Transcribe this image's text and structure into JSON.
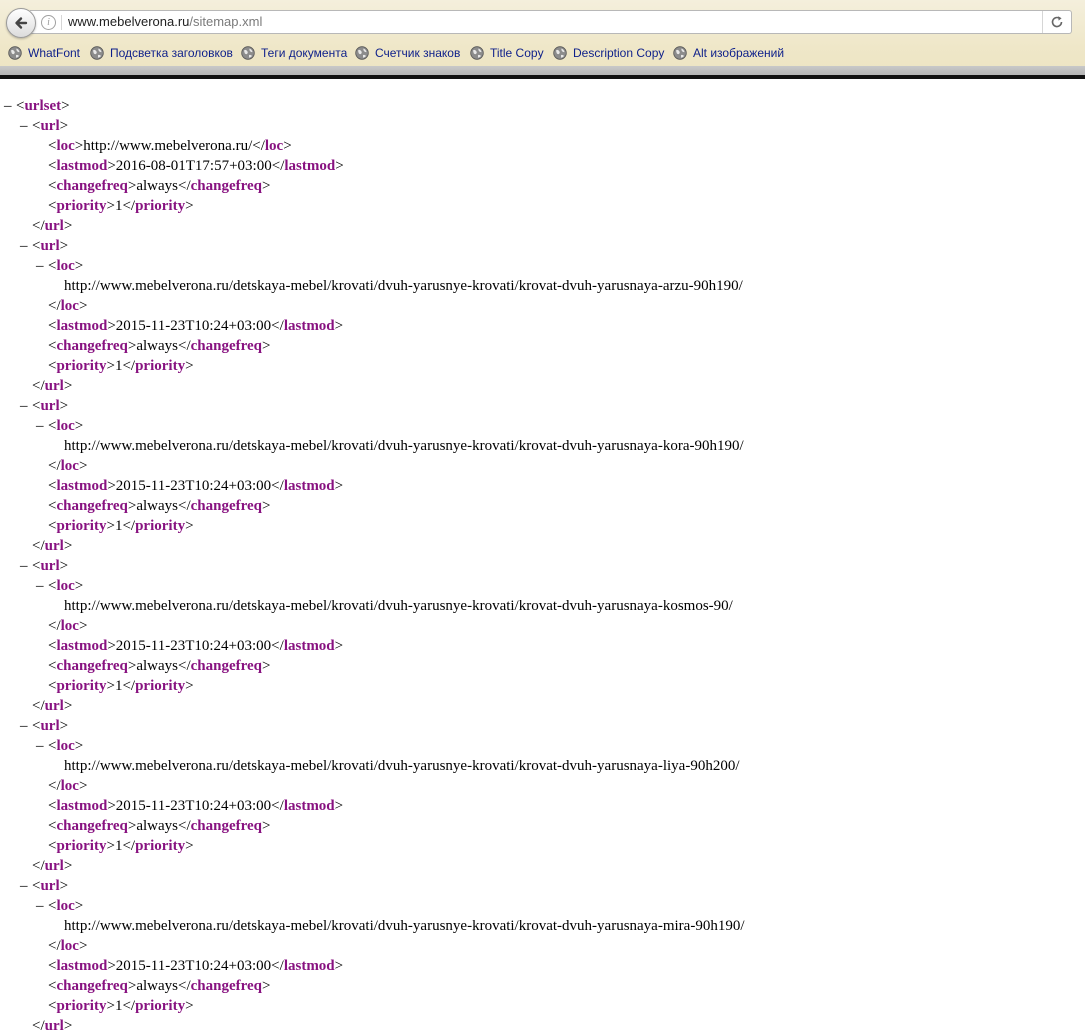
{
  "browser": {
    "url_host": "www.mebelverona.ru",
    "url_path": "/sitemap.xml",
    "bookmarks": [
      {
        "label": "WhatFont"
      },
      {
        "label": "Подсветка заголовков"
      },
      {
        "label": "Теги документа"
      },
      {
        "label": "Счетчик знаков"
      },
      {
        "label": "Title Copy"
      },
      {
        "label": "Description Copy"
      },
      {
        "label": "Alt изображений"
      }
    ]
  },
  "xml": {
    "root_tag": "urlset",
    "toggle_symbol": "–",
    "entries": [
      {
        "loc": "http://www.mebelverona.ru/",
        "lastmod": "2016-08-01T17:57+03:00",
        "changefreq": "always",
        "priority": "1"
      },
      {
        "loc": "http://www.mebelverona.ru/detskaya-mebel/krovati/dvuh-yarusnye-krovati/krovat-dvuh-yarusnaya-arzu-90h190/",
        "lastmod": "2015-11-23T10:24+03:00",
        "changefreq": "always",
        "priority": "1"
      },
      {
        "loc": "http://www.mebelverona.ru/detskaya-mebel/krovati/dvuh-yarusnye-krovati/krovat-dvuh-yarusnaya-kora-90h190/",
        "lastmod": "2015-11-23T10:24+03:00",
        "changefreq": "always",
        "priority": "1"
      },
      {
        "loc": "http://www.mebelverona.ru/detskaya-mebel/krovati/dvuh-yarusnye-krovati/krovat-dvuh-yarusnaya-kosmos-90/",
        "lastmod": "2015-11-23T10:24+03:00",
        "changefreq": "always",
        "priority": "1"
      },
      {
        "loc": "http://www.mebelverona.ru/detskaya-mebel/krovati/dvuh-yarusnye-krovati/krovat-dvuh-yarusnaya-liya-90h200/",
        "lastmod": "2015-11-23T10:24+03:00",
        "changefreq": "always",
        "priority": "1"
      },
      {
        "loc": "http://www.mebelverona.ru/detskaya-mebel/krovati/dvuh-yarusnye-krovati/krovat-dvuh-yarusnaya-mira-90h190/",
        "lastmod": "2015-11-23T10:24+03:00",
        "changefreq": "always",
        "priority": "1"
      }
    ]
  }
}
